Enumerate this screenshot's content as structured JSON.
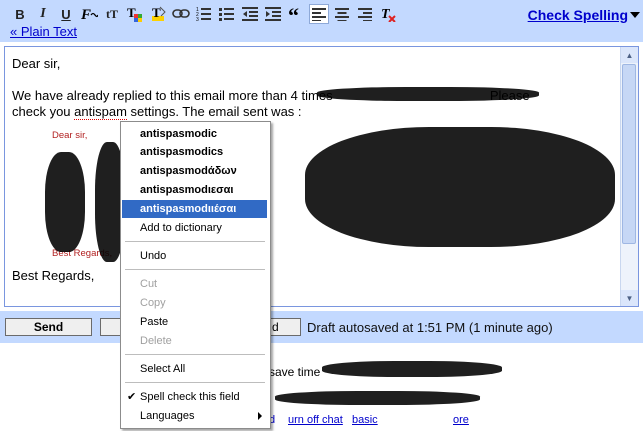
{
  "toolbar": {
    "icons": [
      "bold-icon",
      "italic-icon",
      "underline-icon",
      "font-icon",
      "font-size-icon",
      "text-color-icon",
      "highlight-icon",
      "link-icon",
      "numbered-list-icon",
      "bulleted-list-icon",
      "outdent-icon",
      "indent-icon",
      "quote-icon",
      "align-left-icon",
      "align-center-icon",
      "align-right-icon",
      "remove-formatting-icon"
    ],
    "bold_label": "B",
    "italic_label": "I",
    "underline_label": "U",
    "font_size_label": "tT",
    "plain_text_link": "« Plain Text",
    "check_spelling": "Check Spelling"
  },
  "editor": {
    "greeting": "Dear sir,",
    "line1": "We have already replied to this email more than 4 times",
    "line1_tail": "Please",
    "line2_pre": "check you ",
    "misspelled": "antispam",
    "line2_post": " settings. The email sent was :",
    "quoted_greeting": "Dear sir,",
    "quoted_regards": "Best Regards,",
    "closing": "Best Regards,"
  },
  "actions": {
    "send_label": "Send",
    "discard_label": "d",
    "autosaved_text": "Draft autosaved at 1:51 PM (1 minute ago)"
  },
  "behind_text": {
    "fragment1": "save time",
    "fragment2": "d",
    "fragment3": "urn off chat",
    "fragment4": "basic",
    "fragment5": "ore"
  },
  "context_menu": {
    "suggestions": [
      "antispasmodic",
      "antispasmodics",
      "antispasmodάδων",
      "antispasmodιεσαι",
      "antispasmodιιέσαι"
    ],
    "selected_suggestion_index": 4,
    "add_to_dictionary": "Add to dictionary",
    "undo": "Undo",
    "cut": "Cut",
    "copy": "Copy",
    "paste": "Paste",
    "delete": "Delete",
    "select_all": "Select All",
    "spell_check_field": "Spell check this field",
    "spell_check_checked": true,
    "languages": "Languages"
  },
  "colors": {
    "toolbar_bg": "#c3d9ff",
    "link": "#0000cc",
    "menu_highlight": "#316ac5",
    "quoted_text": "#b22222"
  }
}
